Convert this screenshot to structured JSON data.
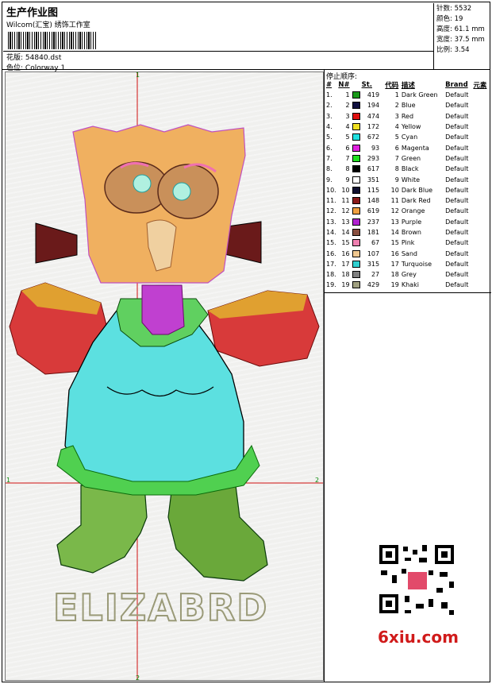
{
  "header": {
    "title": "生产作业图",
    "company": "Wilcom(汇宝) 绣饰工作室",
    "design_label": "花版:",
    "design_value": "54840.dst",
    "colorway_label": "色位:",
    "colorway_value": "Colorway 1"
  },
  "stats": [
    {
      "label": "针数:",
      "value": "5532"
    },
    {
      "label": "颜色:",
      "value": "19"
    },
    {
      "label": "高度:",
      "value": "61.1 mm"
    },
    {
      "label": "宽度:",
      "value": "37.5 mm"
    },
    {
      "label": "比例:",
      "value": "3.54"
    }
  ],
  "axes": {
    "top": "1",
    "left": "1",
    "right": "2",
    "bottom": "2"
  },
  "stop_sequence": {
    "title": "停止顺序:",
    "columns": [
      "#",
      "N#",
      "St.",
      "代码",
      "描述",
      "Brand",
      "元素"
    ],
    "rows": [
      {
        "i": "1.",
        "n": "1",
        "color": "#1a9a1a",
        "st": "419",
        "code": "1",
        "desc": "Dark Green",
        "brand": "Default"
      },
      {
        "i": "2.",
        "n": "2",
        "color": "#101040",
        "st": "194",
        "code": "2",
        "desc": "Blue",
        "brand": "Default"
      },
      {
        "i": "3.",
        "n": "3",
        "color": "#e01010",
        "st": "474",
        "code": "3",
        "desc": "Red",
        "brand": "Default"
      },
      {
        "i": "4.",
        "n": "4",
        "color": "#f0e020",
        "st": "172",
        "code": "4",
        "desc": "Yellow",
        "brand": "Default"
      },
      {
        "i": "5.",
        "n": "5",
        "color": "#20e0e0",
        "st": "672",
        "code": "5",
        "desc": "Cyan",
        "brand": "Default"
      },
      {
        "i": "6.",
        "n": "6",
        "color": "#e020e0",
        "st": "93",
        "code": "6",
        "desc": "Magenta",
        "brand": "Default"
      },
      {
        "i": "7.",
        "n": "7",
        "color": "#20e020",
        "st": "293",
        "code": "7",
        "desc": "Green",
        "brand": "Default"
      },
      {
        "i": "8.",
        "n": "8",
        "color": "#000000",
        "st": "617",
        "code": "8",
        "desc": "Black",
        "brand": "Default"
      },
      {
        "i": "9.",
        "n": "9",
        "color": "#ffffff",
        "st": "351",
        "code": "9",
        "desc": "White",
        "brand": "Default"
      },
      {
        "i": "10.",
        "n": "10",
        "color": "#101030",
        "st": "115",
        "code": "10",
        "desc": "Dark Blue",
        "brand": "Default"
      },
      {
        "i": "11.",
        "n": "11",
        "color": "#8a1a1a",
        "st": "148",
        "code": "11",
        "desc": "Dark Red",
        "brand": "Default"
      },
      {
        "i": "12.",
        "n": "12",
        "color": "#f0a040",
        "st": "619",
        "code": "12",
        "desc": "Orange",
        "brand": "Default"
      },
      {
        "i": "13.",
        "n": "13",
        "color": "#b020d0",
        "st": "237",
        "code": "13",
        "desc": "Purple",
        "brand": "Default"
      },
      {
        "i": "14.",
        "n": "14",
        "color": "#8a5040",
        "st": "181",
        "code": "14",
        "desc": "Brown",
        "brand": "Default"
      },
      {
        "i": "15.",
        "n": "15",
        "color": "#f080b0",
        "st": "67",
        "code": "15",
        "desc": "Pink",
        "brand": "Default"
      },
      {
        "i": "16.",
        "n": "16",
        "color": "#f0c890",
        "st": "107",
        "code": "16",
        "desc": "Sand",
        "brand": "Default"
      },
      {
        "i": "17.",
        "n": "17",
        "color": "#30d0d0",
        "st": "315",
        "code": "17",
        "desc": "Turquoise",
        "brand": "Default"
      },
      {
        "i": "18.",
        "n": "18",
        "color": "#808080",
        "st": "27",
        "code": "18",
        "desc": "Grey",
        "brand": "Default"
      },
      {
        "i": "19.",
        "n": "19",
        "color": "#a0a080",
        "st": "429",
        "code": "19",
        "desc": "Khaki",
        "brand": "Default"
      }
    ]
  },
  "design_text": "ELIZABRD",
  "watermark": "6xiu.com"
}
